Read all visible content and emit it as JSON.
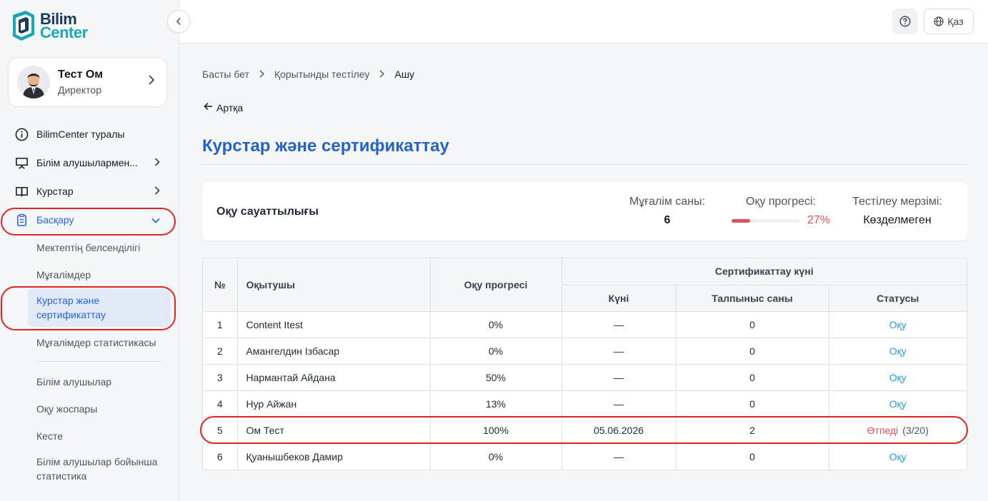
{
  "logo": {
    "line1": "Bilim",
    "line2": "Center"
  },
  "user": {
    "name": "Тест Ом",
    "role": "Директор"
  },
  "nav": {
    "about": "BilimCenter туралы",
    "learners": "Білім алушылармен...",
    "courses": "Курстар",
    "manage": "Басқару",
    "sub": {
      "school_activity": "Мектептің белсенділігі",
      "teachers": "Мұғалімдер",
      "courses_cert": "Курстар және сертификаттау",
      "teacher_stats": "Мұғалімдер статистикасы",
      "learners": "Білім алушылар",
      "study_plan": "Оқу жоспары",
      "schedule": "Кесте",
      "learner_stats": "Білім алушылар бойынша статистика"
    }
  },
  "topbar": {
    "lang": "Қаз"
  },
  "breadcrumb": {
    "home": "Басты бет",
    "final_test": "Қорытынды тестілеу",
    "current": "Ашу"
  },
  "back": "Артқа",
  "page_title": "Курстар және сертификаттау",
  "summary": {
    "title": "Оқу сауаттылығы",
    "teachers_label": "Мұғалім саны:",
    "teachers_value": "6",
    "progress_label": "Оқу прогресі:",
    "progress_value": "27%",
    "progress_fraction": 0.27,
    "deadline_label": "Тестілеу мерзімі:",
    "deadline_value": "Көзделмеген"
  },
  "table": {
    "headers": {
      "num": "№",
      "teacher": "Оқытушы",
      "progress": "Оқу прогресі",
      "cert_group": "Сертификаттау күні",
      "date": "Күні",
      "attempts": "Талпыныс саны",
      "status": "Статусы"
    },
    "rows": [
      {
        "num": "1",
        "name": "Content Itest",
        "progress": "0%",
        "date": "—",
        "attempts": "0",
        "status": "Оқу",
        "status_extra": ""
      },
      {
        "num": "2",
        "name": "Амангелдин Ізбасар",
        "progress": "0%",
        "date": "—",
        "attempts": "0",
        "status": "Оқу",
        "status_extra": ""
      },
      {
        "num": "3",
        "name": "Нармантай Айдана",
        "progress": "50%",
        "date": "—",
        "attempts": "0",
        "status": "Оқу",
        "status_extra": ""
      },
      {
        "num": "4",
        "name": "Нур Айжан",
        "progress": "13%",
        "date": "—",
        "attempts": "0",
        "status": "Оқу",
        "status_extra": ""
      },
      {
        "num": "5",
        "name": "Ом Тест",
        "progress": "100%",
        "date": "05.06.2026",
        "attempts": "2",
        "status": "Өтпеді",
        "status_extra": "(3/20)"
      },
      {
        "num": "6",
        "name": "Қуанышбеков Дамир",
        "progress": "0%",
        "date": "—",
        "attempts": "0",
        "status": "Оқу",
        "status_extra": ""
      }
    ]
  },
  "colors": {
    "accent": "#2563eb",
    "title": "#2563c9",
    "link": "#2b9be0",
    "fail": "#e0505c",
    "highlight_ring": "#e02424"
  }
}
